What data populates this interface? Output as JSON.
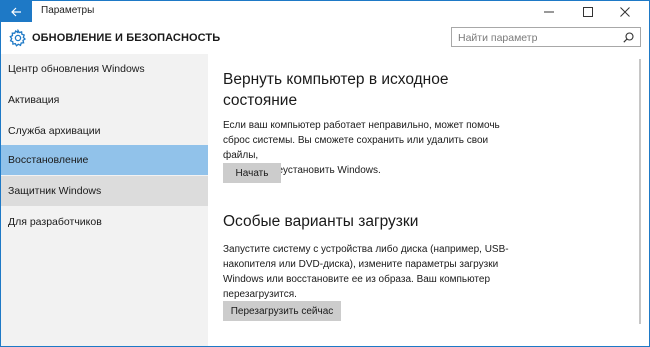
{
  "window": {
    "title": "Параметры"
  },
  "header": {
    "title": "ОБНОВЛЕНИЕ И БЕЗОПАСНОСТЬ",
    "search_placeholder": "Найти параметр"
  },
  "sidebar": {
    "items": [
      {
        "label": "Центр обновления Windows",
        "state": "normal"
      },
      {
        "label": "Активация",
        "state": "normal"
      },
      {
        "label": "Служба архивации",
        "state": "normal"
      },
      {
        "label": "Восстановление",
        "state": "selected"
      },
      {
        "label": "Защитник Windows",
        "state": "hover"
      },
      {
        "label": "Для разработчиков",
        "state": "normal"
      }
    ]
  },
  "main": {
    "reset": {
      "title_line1": "Вернуть компьютер в исходное",
      "title_line2": "состояние",
      "desc_line1": "Если ваш компьютер работает неправильно, может помочь",
      "desc_line2": "сброс системы. Вы сможете сохранить или удалить свои файлы,",
      "desc_line3": "и затем переустановить Windows.",
      "button": "Начать"
    },
    "advanced": {
      "title": "Особые варианты загрузки",
      "desc_line1": "Запустите систему с устройства либо диска (например, USB-",
      "desc_line2": "накопителя или DVD-диска), измените параметры загрузки",
      "desc_line3": "Windows или восстановите ее из образа. Ваш компьютер",
      "desc_line4": "перезагрузится.",
      "button": "Перезагрузить сейчас"
    }
  },
  "colors": {
    "accent": "#1e79c6",
    "selected": "#91c2ea",
    "hover": "#dcdcdc",
    "sidebar_bg": "#f2f2f2",
    "button_bg": "#cccccc"
  }
}
